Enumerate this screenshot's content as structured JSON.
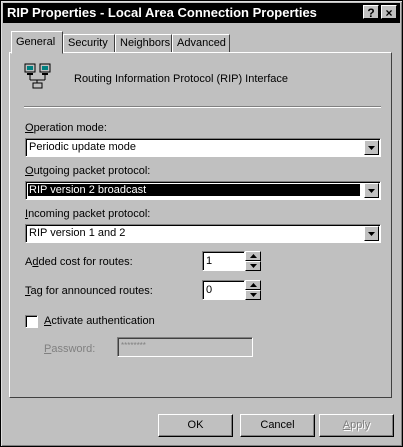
{
  "window": {
    "title": "RIP Properties - Local Area Connection Properties",
    "help_glyph": "?",
    "close_glyph": "×"
  },
  "tabs": [
    {
      "label": "General",
      "selected": true
    },
    {
      "label": "Security"
    },
    {
      "label": "Neighbors"
    },
    {
      "label": "Advanced"
    }
  ],
  "header": {
    "icon": "network-computers-icon",
    "text": "Routing Information Protocol (RIP) Interface"
  },
  "form": {
    "operation_mode": {
      "label_u": "O",
      "label_rest": "peration mode:",
      "value": "Periodic update mode"
    },
    "outgoing": {
      "label_u": "O",
      "label_rest": "utgoing packet protocol:",
      "value": "RIP version 2 broadcast"
    },
    "incoming": {
      "label_u": "I",
      "label_rest": "ncoming packet protocol:",
      "value": "RIP version 1 and 2"
    },
    "added_cost": {
      "label_pre": "A",
      "label_u": "d",
      "label_rest": "ded cost for routes:",
      "value": "1"
    },
    "tag": {
      "label_u": "T",
      "label_rest": "ag for announced routes:",
      "value": "0"
    },
    "auth": {
      "label_u": "A",
      "label_rest": "ctivate authentication",
      "checked": false
    },
    "password": {
      "label_u": "P",
      "label_rest": "assword:",
      "value": "********"
    }
  },
  "buttons": {
    "ok": "OK",
    "cancel": "Cancel",
    "apply_u": "A",
    "apply_rest": "pply"
  }
}
